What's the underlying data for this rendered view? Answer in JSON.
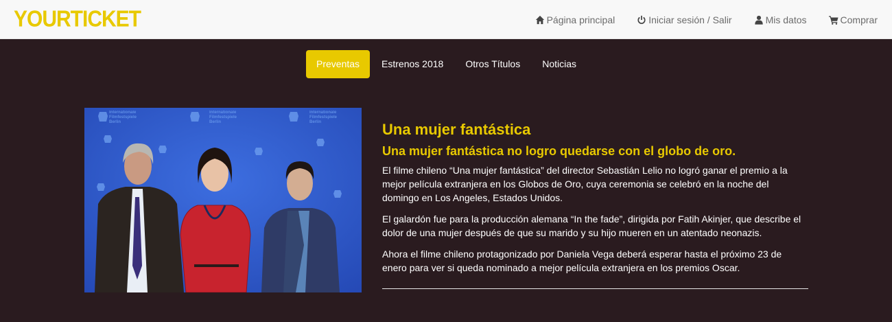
{
  "header": {
    "brand": "YOURTICKET",
    "links": [
      {
        "label": "Página principal",
        "icon": "home-icon"
      },
      {
        "label": "Iniciar sesión / Salir",
        "icon": "power-icon"
      },
      {
        "label": "Mis datos",
        "icon": "user-icon"
      },
      {
        "label": "Comprar",
        "icon": "cart-icon"
      }
    ]
  },
  "menu": {
    "items": [
      {
        "label": "Preventas",
        "active": true
      },
      {
        "label": "Estrenos 2018",
        "active": false
      },
      {
        "label": "Otros Títulos",
        "active": false
      },
      {
        "label": "Noticias",
        "active": false
      }
    ]
  },
  "article": {
    "title": "Una mujer fantástica",
    "subtitle": "Una mujer fantástica no logro quedarse con el globo de oro.",
    "paragraphs": [
      "El filme chileno “Una mujer fantástica” del director Sebastián Lelio no logró ganar el premio a la mejor película extranjera en los Globos de Oro, cuya ceremonia se celebró en la noche del domingo en Los Angeles, Estados Unidos.",
      "El galardón fue para la producción alemana “In the fade”, dirigida por Fatih Akinjer, que describe el dolor de una mujer después de que su marido y su hijo mueren en un atentado neonazis.",
      "Ahora el filme chileno protagonizado por Daniela Vega deberá esperar hasta el próximo 23 de enero para ver si queda nominado a mejor película extranjera en los premios Oscar."
    ]
  },
  "photo": {
    "backdrop_text": [
      "Internationale",
      "Filmfestspiele",
      "Berlin"
    ]
  },
  "colors": {
    "accent": "#e8c900",
    "page_background": "#2a1b1f",
    "navbar_background": "#f8f8f8"
  }
}
